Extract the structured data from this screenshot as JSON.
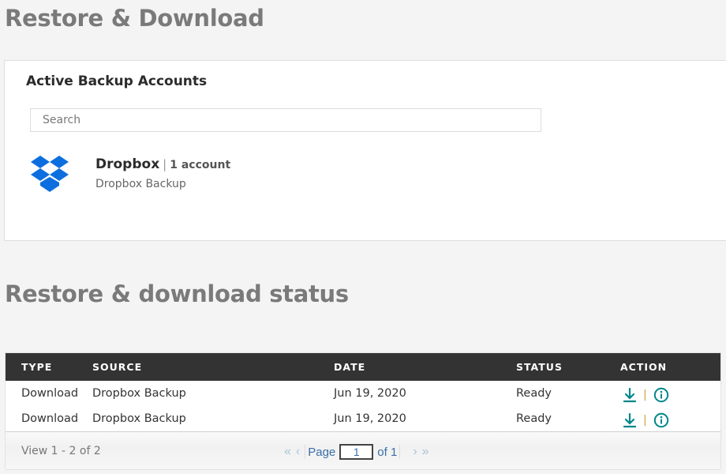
{
  "page": {
    "title": "Restore & Download"
  },
  "accounts": {
    "title": "Active Backup Accounts",
    "search_placeholder": "Search",
    "search_value": "",
    "items": [
      {
        "name": "Dropbox",
        "separator": "|",
        "count": "1 account",
        "subtitle": "Dropbox Backup",
        "icon": "dropbox-icon",
        "icon_color": "#0d6fdf"
      }
    ]
  },
  "status": {
    "title": "Restore & download status",
    "columns": [
      "TYPE",
      "SOURCE",
      "DATE",
      "STATUS",
      "ACTION"
    ],
    "rows": [
      {
        "type": "Download",
        "source": "Dropbox Backup",
        "date": "Jun 19, 2020",
        "status": "Ready",
        "actions": [
          "download-icon",
          "info-icon"
        ],
        "action_sep": "|"
      },
      {
        "type": "Download",
        "source": "Dropbox Backup",
        "date": "Jun 19, 2020",
        "status": "Ready",
        "actions": [
          "download-icon",
          "info-icon"
        ],
        "action_sep": "|"
      }
    ],
    "footer": {
      "view_text": "View 1 - 2 of 2",
      "page_label": "Page",
      "page_value": "1",
      "of_label": "of 1",
      "first_icon": "«",
      "prev_icon": "‹",
      "next_icon": "›",
      "last_icon": "»"
    },
    "accent_color": "#00868b",
    "header_bg": "#333333"
  }
}
